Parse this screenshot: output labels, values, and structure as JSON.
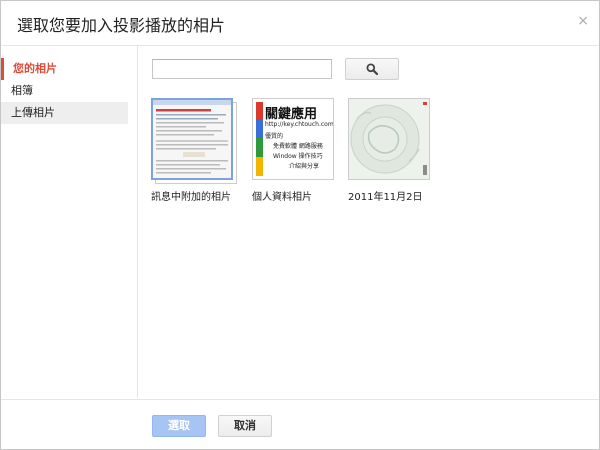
{
  "dialog": {
    "title": "選取您要加入投影播放的相片",
    "close_label": "×"
  },
  "sidebar": {
    "items": [
      {
        "label": "您的相片"
      },
      {
        "label": "相簿"
      },
      {
        "label": "上傳相片"
      }
    ]
  },
  "search": {
    "value": "",
    "placeholder": "",
    "icon": "search-icon"
  },
  "albums": [
    {
      "label": "訊息中附加的相片"
    },
    {
      "label": "個人資料相片",
      "thumb_title": "關鍵應用",
      "thumb_url": "http://key.chtouch.com",
      "thumb_lines": [
        "優質的",
        "免費軟體 網路服務",
        "Window 操作技巧",
        "介紹與分享"
      ]
    },
    {
      "label": "2011年11月2日"
    }
  ],
  "footer": {
    "select_label": "選取",
    "cancel_label": "取消"
  },
  "colors": {
    "accent": "#dd4b39",
    "primary_disabled": "#a6c4f4"
  }
}
